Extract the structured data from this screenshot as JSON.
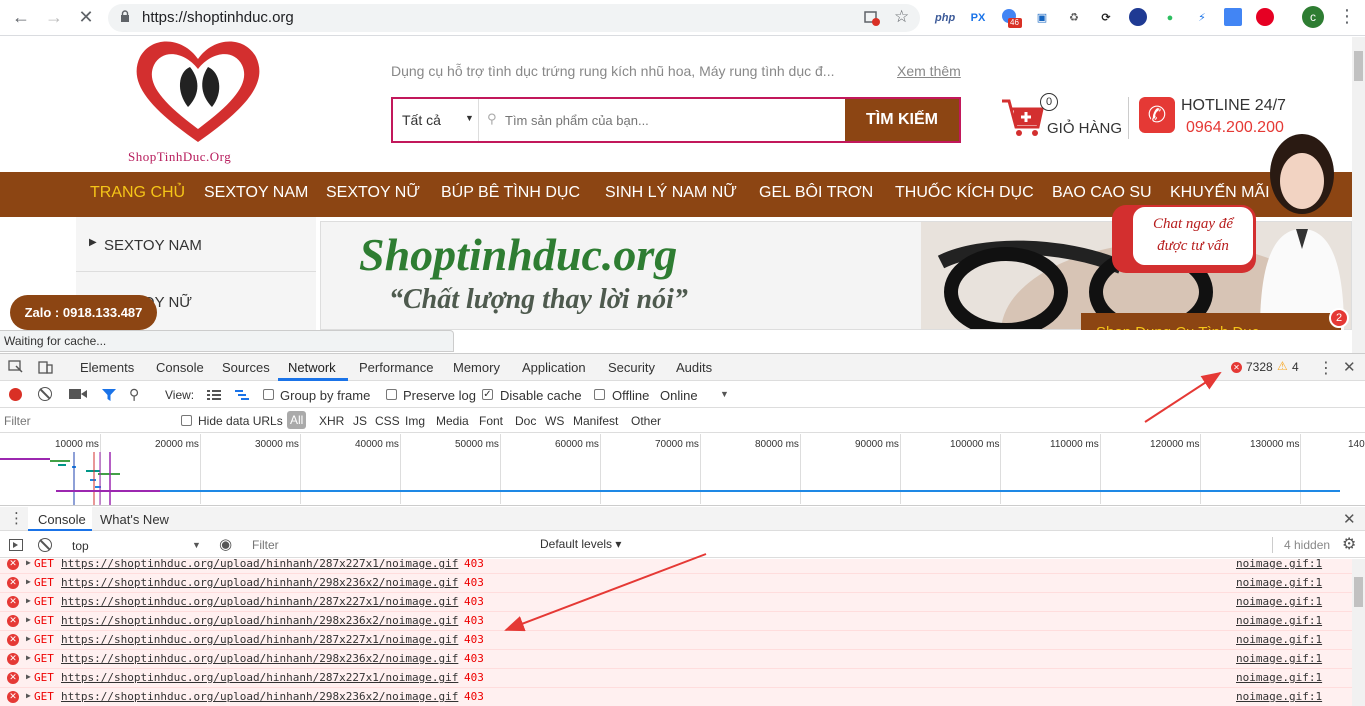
{
  "browser": {
    "url": "https://shoptinhduc.org",
    "extensions": [
      "php",
      "PX",
      "46"
    ]
  },
  "site": {
    "logo_text": "ShopTinhDuc.Org",
    "promo_text": "Dụng cụ hỗ trợ tình dục trứng rung kích nhũ hoa, Máy rung tình dục đ...",
    "promo_link": "Xem thêm",
    "category_select": "Tất cả",
    "search_placeholder": "Tìm sản phẩm của bạn...",
    "search_button": "TÌM KIẾM",
    "cart_count": "0",
    "cart_label": "GIỎ HÀNG",
    "hotline_label": "HOTLINE 24/7",
    "hotline_number": "0964.200.200",
    "menu": [
      "TRANG CHỦ",
      "SEXTOY NAM",
      "SEXTOY NỮ",
      "BÚP BÊ TÌNH DỤC",
      "SINH LÝ NAM NỮ",
      "GEL BÔI TRƠN",
      "THUỐC KÍCH DỤC",
      "BAO CAO SU",
      "KHUYẾN MÃI"
    ],
    "sidebar": [
      "SEXTOY NAM",
      "SEXTOY NỮ"
    ],
    "banner_title": "Shoptinhduc.org",
    "banner_slogan": "“Chất lượng thay lời nói”",
    "chat_bubble": "Chat ngay để được tư vấn",
    "chat_bar": "Shop Dụng Cụ Tình Dục",
    "chat_badge": "2",
    "zalo": "Zalo : 0918.133.487",
    "status": "Waiting for cache..."
  },
  "devtools": {
    "tabs": [
      "Elements",
      "Console",
      "Sources",
      "Network",
      "Performance",
      "Memory",
      "Application",
      "Security",
      "Audits"
    ],
    "active_tab": "Network",
    "errors": "7328",
    "warnings": "4",
    "view_label": "View:",
    "group_by_frame": "Group by frame",
    "preserve_log": "Preserve log",
    "disable_cache": "Disable cache",
    "offline": "Offline",
    "throttle": "Online",
    "filter_placeholder": "Filter",
    "hide_data_urls": "Hide data URLs",
    "types": [
      "All",
      "XHR",
      "JS",
      "CSS",
      "Img",
      "Media",
      "Font",
      "Doc",
      "WS",
      "Manifest",
      "Other"
    ],
    "ticks": [
      "10000 ms",
      "20000 ms",
      "30000 ms",
      "40000 ms",
      "50000 ms",
      "60000 ms",
      "70000 ms",
      "80000 ms",
      "90000 ms",
      "100000 ms",
      "110000 ms",
      "120000 ms",
      "130000 ms",
      "140"
    ],
    "drawer_tabs": [
      "Console",
      "What's New"
    ],
    "context": "top",
    "console_filter": "Filter",
    "levels": "Default levels ▾",
    "hidden": "4 hidden",
    "logs": [
      {
        "method": "GET",
        "url": "https://shoptinhduc.org/upload/hinhanh/287x227x1/noimage.gif",
        "status": "403",
        "source": "noimage.gif:1"
      },
      {
        "method": "GET",
        "url": "https://shoptinhduc.org/upload/hinhanh/298x236x2/noimage.gif",
        "status": "403",
        "source": "noimage.gif:1"
      },
      {
        "method": "GET",
        "url": "https://shoptinhduc.org/upload/hinhanh/287x227x1/noimage.gif",
        "status": "403",
        "source": "noimage.gif:1"
      },
      {
        "method": "GET",
        "url": "https://shoptinhduc.org/upload/hinhanh/298x236x2/noimage.gif",
        "status": "403",
        "source": "noimage.gif:1"
      },
      {
        "method": "GET",
        "url": "https://shoptinhduc.org/upload/hinhanh/287x227x1/noimage.gif",
        "status": "403",
        "source": "noimage.gif:1"
      },
      {
        "method": "GET",
        "url": "https://shoptinhduc.org/upload/hinhanh/298x236x2/noimage.gif",
        "status": "403",
        "source": "noimage.gif:1"
      },
      {
        "method": "GET",
        "url": "https://shoptinhduc.org/upload/hinhanh/287x227x1/noimage.gif",
        "status": "403",
        "source": "noimage.gif:1"
      },
      {
        "method": "GET",
        "url": "https://shoptinhduc.org/upload/hinhanh/298x236x2/noimage.gif",
        "status": "403",
        "source": "noimage.gif:1"
      }
    ]
  },
  "colors": {
    "brand": "#8c4513",
    "accent": "#c2185b",
    "error": "#e53935",
    "menu_active": "#f5c518"
  }
}
